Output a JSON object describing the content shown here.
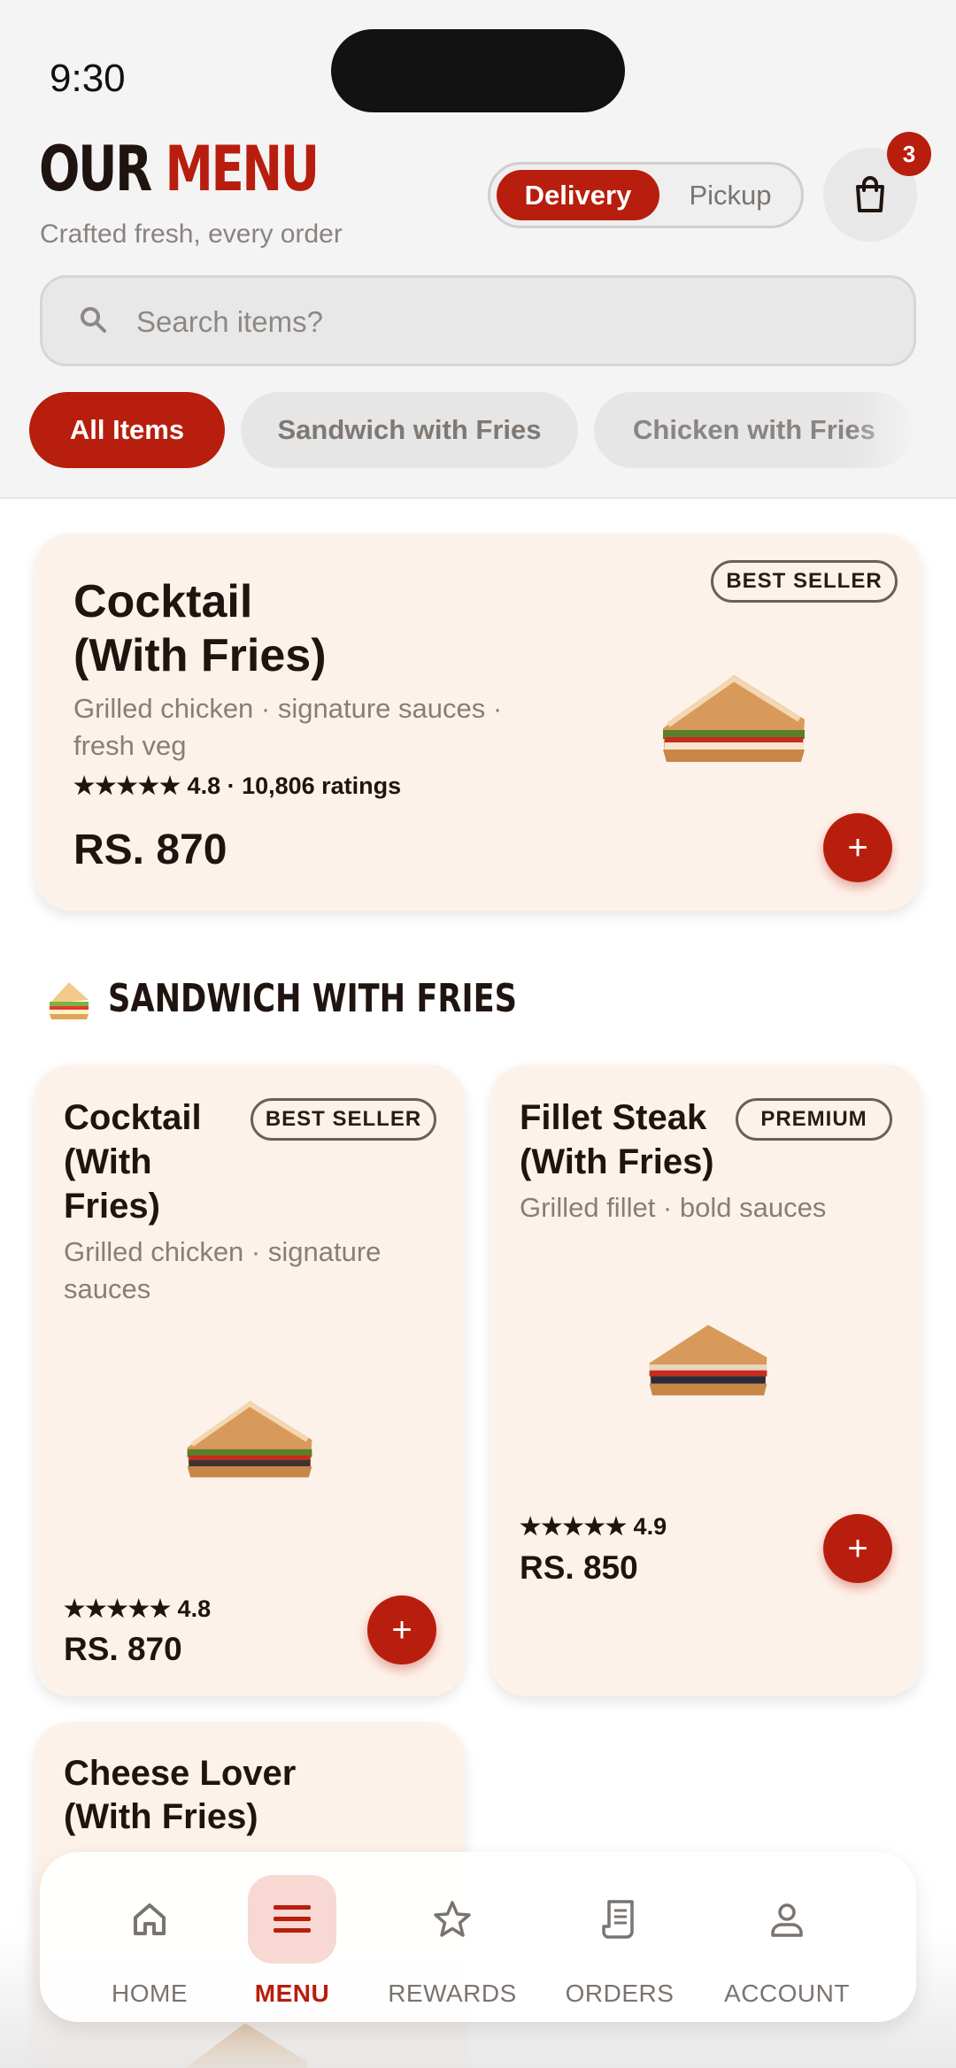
{
  "status_bar": {
    "time": "9:30"
  },
  "header": {
    "title_part1": "OUR",
    "title_part2": "MENU",
    "subtitle": "Crafted fresh, every order",
    "mode_toggle": {
      "active": "Delivery",
      "inactive": "Pickup"
    },
    "cart_count": "3",
    "accent_color": "#b81e0d"
  },
  "search": {
    "placeholder": "Search items?"
  },
  "categories": [
    {
      "label": "All Items",
      "active": true
    },
    {
      "label": "Sandwich with Fries",
      "active": false
    },
    {
      "label": "Chicken with Fries",
      "active": false
    }
  ],
  "featured": {
    "badge": "BEST SELLER",
    "name_line1": "Cocktail",
    "name_line2": "(With Fries)",
    "desc_line1": "Grilled chicken · signature sauces ·",
    "desc_line2": "fresh veg",
    "stars": "★★★★★",
    "rating": "4.8 · 10,806 ratings",
    "price": "RS. 870",
    "add_icon": "+"
  },
  "section": {
    "title": "SANDWICH WITH FRIES",
    "icon": "sandwich-emoji"
  },
  "items": [
    {
      "badge": "BEST SELLER",
      "name_lines": [
        "Cocktail",
        "(With",
        "Fries)"
      ],
      "desc_lines": [
        "Grilled chicken · signature",
        "sauces"
      ],
      "stars": "★★★★★",
      "rating": "4.8",
      "price": "RS. 870",
      "add_icon": "+"
    },
    {
      "badge": "PREMIUM",
      "name_lines": [
        "Fillet Steak",
        "(With Fries)"
      ],
      "desc_lines": [
        "Grilled fillet · bold sauces"
      ],
      "stars": "★★★★★",
      "rating": "4.9",
      "price": "RS. 850",
      "add_icon": "+"
    },
    {
      "name_lines": [
        "Cheese Lover",
        "(With Fries)"
      ]
    }
  ],
  "bottom_nav": [
    {
      "label": "HOME",
      "icon": "home-icon",
      "active": false
    },
    {
      "label": "MENU",
      "icon": "menu-icon",
      "active": true
    },
    {
      "label": "REWARDS",
      "icon": "star-icon",
      "active": false
    },
    {
      "label": "ORDERS",
      "icon": "receipt-icon",
      "active": false
    },
    {
      "label": "ACCOUNT",
      "icon": "user-icon",
      "active": false
    }
  ]
}
